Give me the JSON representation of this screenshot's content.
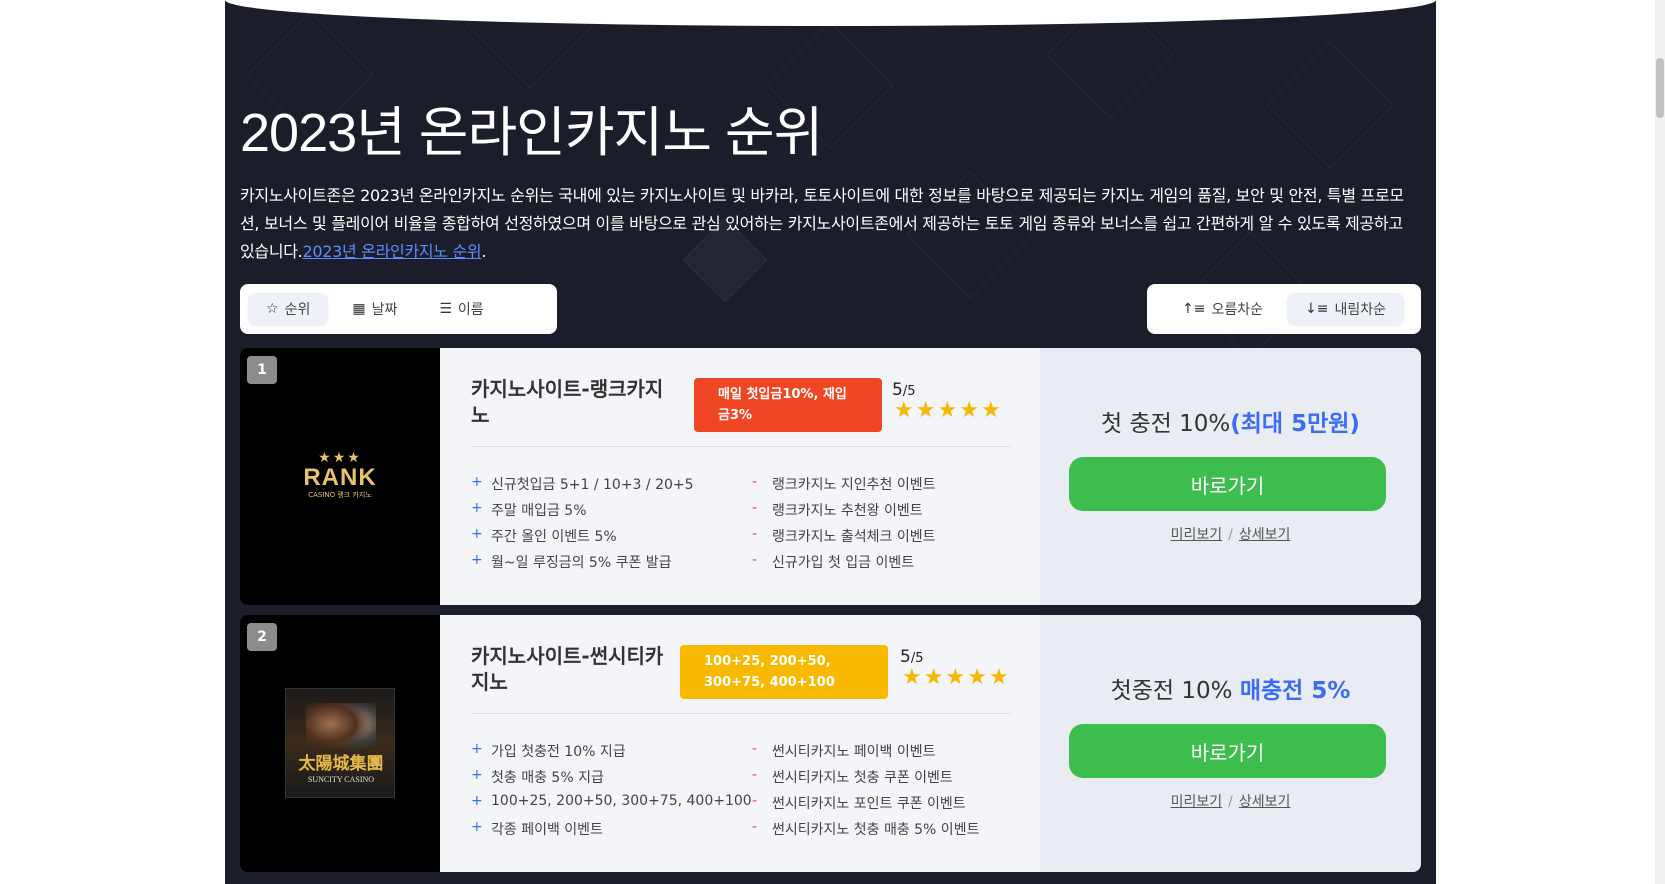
{
  "page": {
    "title": "2023년 온라인카지노 순위",
    "description": "카지노사이트존은 2023년 온라인카지노 순위는 국내에 있는 카지노사이트 및 바카라, 토토사이트에 대한 정보를 바탕으로 제공되는 카지노 게임의 품질, 보안 및 안전, 특별 프로모션, 보너스 및 플레이어 비율을 종합하여 선정하였으며 이를 바탕으로 관심 있어하는 카지노사이트존에서 제공하는 토토 게임 종류와 보너스를 쉽고 간편하게 알 수 있도록 제공하고 있습니다.",
    "description_link": "2023년 온라인카지노 순위",
    "description_end": "."
  },
  "sort": {
    "left": [
      {
        "label": "순위",
        "icon": "star-icon",
        "active": true
      },
      {
        "label": "날짜",
        "icon": "calendar-icon",
        "active": false
      },
      {
        "label": "이름",
        "icon": "list-icon",
        "active": false
      }
    ],
    "right": [
      {
        "label": "오름차순",
        "icon": "sort-ascending-icon",
        "active": false
      },
      {
        "label": "내림차순",
        "icon": "sort-descending-icon",
        "active": true
      }
    ]
  },
  "cards": [
    {
      "rank": "1",
      "name": "카지노사이트-랭크카지노",
      "promo": "매일 첫입금10%, 재입금3%",
      "promo_color": "#ef4623",
      "rating": "5",
      "rating_max": "/5",
      "features_left": [
        "신규첫입금 5+1 / 10+3 / 20+5",
        "주말 매입금 5%",
        "주간 올인 이벤트 5%",
        "월~일 루징금의 5% 쿠폰 발급"
      ],
      "features_right": [
        "랭크카지노 지인추천 이벤트",
        "랭크카지노 추천왕 이벤트",
        "랭크카지노 출석체크 이벤트",
        "신규가입 첫 입금 이벤트"
      ],
      "bonus_main": "첫 충전 10%",
      "bonus_highlight": "(최대 5만원)",
      "go_label": "바로가기",
      "preview_label": "미리보기",
      "detail_label": "상세보기",
      "logo_main": "RANK",
      "logo_sub": "CASINO 랭크 카지노",
      "logo_stars": "★★★"
    },
    {
      "rank": "2",
      "name": "카지노사이트-썬시티카지노",
      "promo": "100+25, 200+50, 300+75, 400+100",
      "promo_color": "#f8b900",
      "rating": "5",
      "rating_max": "/5",
      "features_left": [
        "가입 첫충전 10% 지급",
        "첫충 매충 5% 지급",
        "100+25, 200+50, 300+75, 400+100",
        "각종 페이백 이벤트"
      ],
      "features_right": [
        "썬시티카지노 페이백 이벤트",
        "썬시티카지노 첫충 쿠폰 이벤트",
        "썬시티카지노 포인트 쿠폰 이벤트",
        "썬시티카지노 첫충 매충 5% 이벤트"
      ],
      "bonus_main": "첫중전 10%",
      "bonus_highlight": "매충전 5%",
      "go_label": "바로가기",
      "preview_label": "미리보기",
      "detail_label": "상세보기",
      "logo_main": "太陽城集團",
      "logo_sub": "SUNCITY CASINO"
    }
  ],
  "colors": {
    "hero_bg": "#1c1d2b",
    "accent_blue": "#3a6cf4",
    "go_green": "#3ebd4f",
    "star_yellow": "#f5b800"
  }
}
